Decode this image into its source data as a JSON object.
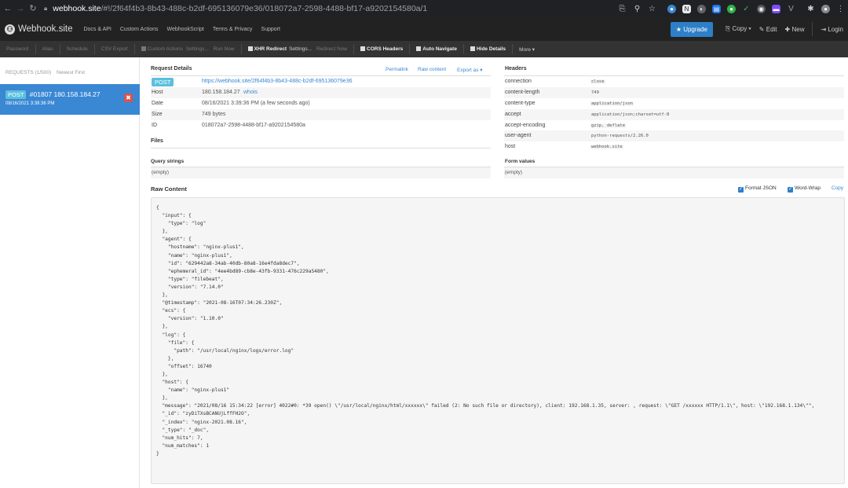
{
  "browser": {
    "url_host": "webhook.site",
    "url_path": "/#!/2f64f4b3-8b43-488c-b2df-695136079e36/018072a7-2598-4488-bf17-a9202154580a/1"
  },
  "navbar": {
    "brand": "Webhook.site",
    "links": [
      "Docs & API",
      "Custom Actions",
      "WebhookScript",
      "Terms & Privacy",
      "Support"
    ],
    "upgrade": "★ Upgrade",
    "copy": "Copy ▾",
    "edit": "Edit",
    "new": "New",
    "login": "Login"
  },
  "toolbar": {
    "password": "Password",
    "alias": "Alias",
    "schedule": "Schedule",
    "csv": "CSV Export",
    "custom_actions": "Custom Actions",
    "settings1": "Settings...",
    "run_now": "Run Now",
    "xhr": "XHR Redirect",
    "settings2": "Settings...",
    "redirect_now": "Redirect Now",
    "cors": "CORS Headers",
    "auto_navigate": "Auto Navigate",
    "hide_details": "Hide Details",
    "more": "More ▾"
  },
  "sidebar": {
    "requests_label": "REQUESTS (1/500)",
    "newest_first": "Newest First",
    "item": {
      "method": "POST",
      "title": "#01807 180.158.184.27",
      "date": "08/16/2021 3:39:36 PM"
    }
  },
  "details": {
    "title": "Request Details",
    "permalink": "Permalink",
    "raw_content": "Raw content",
    "export": "Export as ▾",
    "method": "POST",
    "url": "https://webhook.site/2f64f4b3-8b43-488c-b2df-695136079e36",
    "host_label": "Host",
    "host": "180.158.184.27",
    "whois": "whois",
    "date_label": "Date",
    "date": "08/16/2021 3:39:36 PM (a few seconds ago)",
    "size_label": "Size",
    "size": "749 bytes",
    "id_label": "ID",
    "id": "018072a7-2598-4488-bf17-a9202154580a"
  },
  "files_title": "Files",
  "query": {
    "title": "Query strings",
    "value": "(empty)"
  },
  "form": {
    "title": "Form values",
    "value": "(empty)"
  },
  "headers": {
    "title": "Headers",
    "rows": [
      {
        "k": "connection",
        "v": "close"
      },
      {
        "k": "content-length",
        "v": "749"
      },
      {
        "k": "content-type",
        "v": "application/json"
      },
      {
        "k": "accept",
        "v": "application/json;charset=utf-8"
      },
      {
        "k": "accept-encoding",
        "v": "gzip, deflate"
      },
      {
        "k": "user-agent",
        "v": "python-requests/2.26.0"
      },
      {
        "k": "host",
        "v": "webhook.site"
      }
    ]
  },
  "raw": {
    "title": "Raw Content",
    "format_json": "Format JSON",
    "word_wrap": "Word-Wrap",
    "copy": "Copy",
    "body": "{\n  \"input\": {\n    \"type\": \"log\"\n  },\n  \"agent\": {\n    \"hostname\": \"nginx-plus1\",\n    \"name\": \"nginx-plus1\",\n    \"id\": \"629442a8-34ab-40db-80a8-16e4fda8dec7\",\n    \"ephemeral_id\": \"4ee4bd89-cb8e-43fb-9331-476c229a5480\",\n    \"type\": \"filebeat\",\n    \"version\": \"7.14.0\"\n  },\n  \"@timestamp\": \"2021-08-16T07:34:26.230Z\",\n  \"ecs\": {\n    \"version\": \"1.10.0\"\n  },\n  \"log\": {\n    \"file\": {\n      \"path\": \"/usr/local/nginx/logs/error.log\"\n    },\n    \"offset\": 16740\n  },\n  \"host\": {\n    \"name\": \"nginx-plus1\"\n  },\n  \"message\": \"2021/08/16 15:34:22 [error] 4022#0: *39 open() \\\"/usr/local/nginx/html/xxxxxx\\\" failed (2: No such file or directory), client: 192.168.1.35, server: , request: \\\"GET /xxxxxx HTTP/1.1\\\", host: \\\"192.168.1.134\\\"\",\n  \"_id\": \"zyDiTXsBCANUjLffFH2O\",\n  \"_index\": \"nginx-2021.08.16\",\n  \"_type\": \"_doc\",\n  \"num_hits\": 7,\n  \"num_matches\": 1\n}"
  }
}
